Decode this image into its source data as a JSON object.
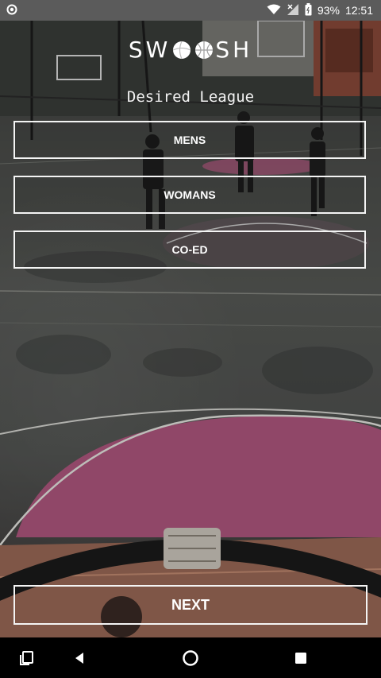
{
  "status_bar": {
    "battery_percent": "93%",
    "time": "12:51",
    "icons": [
      "notification-dot-icon",
      "wifi-icon",
      "signal-icon",
      "battery-icon"
    ]
  },
  "brand": {
    "left": "SW",
    "right": "SH",
    "ball_icons": [
      "volleyball-icon",
      "basketball-icon"
    ]
  },
  "page": {
    "subtitle": "Desired League"
  },
  "league_options": [
    "MENS",
    "WOMANS",
    "CO-ED"
  ],
  "next_label": "NEXT",
  "nav_bar": {
    "icons": [
      "recents-icon",
      "back-icon",
      "home-icon",
      "overview-icon"
    ]
  },
  "colors": {
    "court_purple": "#b0577f",
    "status_bar_bg": "#5b5b5b",
    "nav_bar_bg": "#000000",
    "text": "#ffffff"
  }
}
